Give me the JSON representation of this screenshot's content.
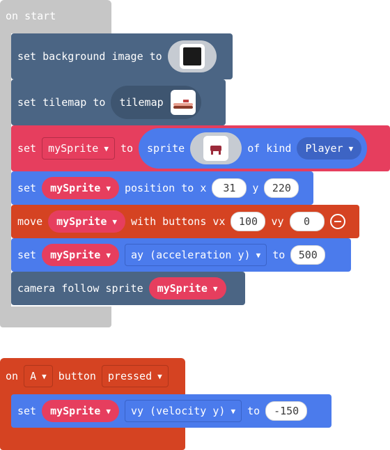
{
  "colors": {
    "hat_gray": "#c6c6c6",
    "scene_blue": "#4b6584",
    "sprite_red": "#e63e5e",
    "sprite_blue": "#4b7bec",
    "controller_orange": "#d54322",
    "variable_red": "#e63e5e"
  },
  "on_start": {
    "label": "on start",
    "background": {
      "label": "set background image to",
      "image_icon": "image-thumbnail-dark-icon"
    },
    "tilemap": {
      "label": "set tilemap to",
      "field": "tilemap",
      "icon": "tilemap-thumbnail-icon"
    },
    "create_sprite": {
      "set": "set",
      "variable": "mySprite",
      "to": "to",
      "sprite": "sprite",
      "image_icon": "sprite-image-icon",
      "of_kind": "of kind",
      "kind": "Player"
    },
    "position": {
      "set": "set",
      "variable": "mySprite",
      "label": "position to x",
      "x": "31",
      "y_label": "y",
      "y": "220"
    },
    "move": {
      "move": "move",
      "variable": "mySprite",
      "label": "with buttons vx",
      "vx": "100",
      "vy_label": "vy",
      "vy": "0"
    },
    "accel": {
      "set": "set",
      "variable": "mySprite",
      "property": "ay (acceleration y)",
      "to": "to",
      "value": "500"
    },
    "camera": {
      "label": "camera follow sprite",
      "variable": "mySprite"
    }
  },
  "on_button": {
    "on": "on",
    "button": "A",
    "label": "button",
    "event": "pressed",
    "velocity": {
      "set": "set",
      "variable": "mySprite",
      "property": "vy (velocity y)",
      "to": "to",
      "value": "-150"
    }
  }
}
